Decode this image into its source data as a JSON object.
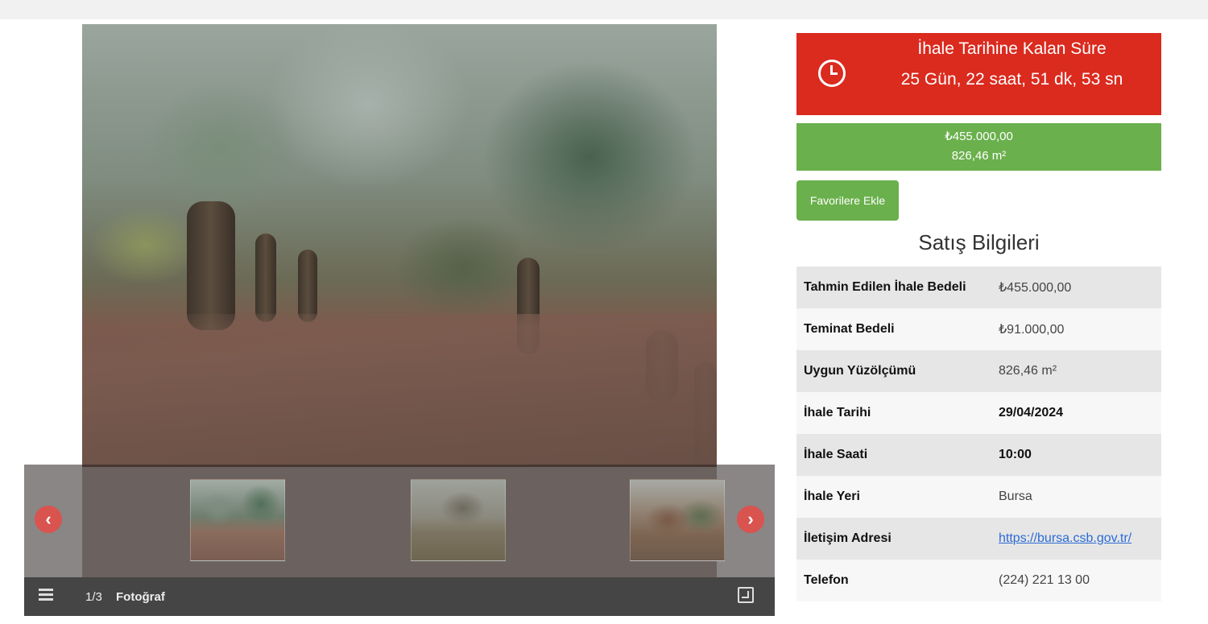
{
  "countdown": {
    "title": "İhale Tarihine Kalan Süre",
    "value": "25 Gün, 22 saat, 51 dk, 53 sn"
  },
  "price": {
    "amount": "₺455.000,00",
    "area": "826,46 m²"
  },
  "favorite_button": "Favorilere Ekle",
  "section_title": "Satış Bilgileri",
  "info": [
    {
      "label": "Tahmin Edilen İhale Bedeli",
      "value": "₺455.000,00"
    },
    {
      "label": "Teminat Bedeli",
      "value": "₺91.000,00"
    },
    {
      "label": "Uygun Yüzölçümü",
      "value": "826,46 m²"
    },
    {
      "label": "İhale Tarihi",
      "value": "29/04/2024"
    },
    {
      "label": "İhale Saati",
      "value": "10:00"
    },
    {
      "label": "İhale Yeri",
      "value": "Bursa"
    },
    {
      "label": "İletişim Adresi",
      "value": "https://bursa.csb.gov.tr/"
    },
    {
      "label": "Telefon",
      "value": "(224) 221 13 00"
    }
  ],
  "gallery": {
    "counter": "1/3",
    "caption": "Fotoğraf",
    "prev_symbol": "‹",
    "next_symbol": "›"
  },
  "colors": {
    "countdown_bg": "#db2a1e",
    "success_green": "#6ab04c",
    "nav_red": "#d9534f"
  },
  "icons": [
    "clock-icon",
    "chevron-left-icon",
    "chevron-right-icon",
    "list-icon",
    "fullscreen-icon"
  ]
}
